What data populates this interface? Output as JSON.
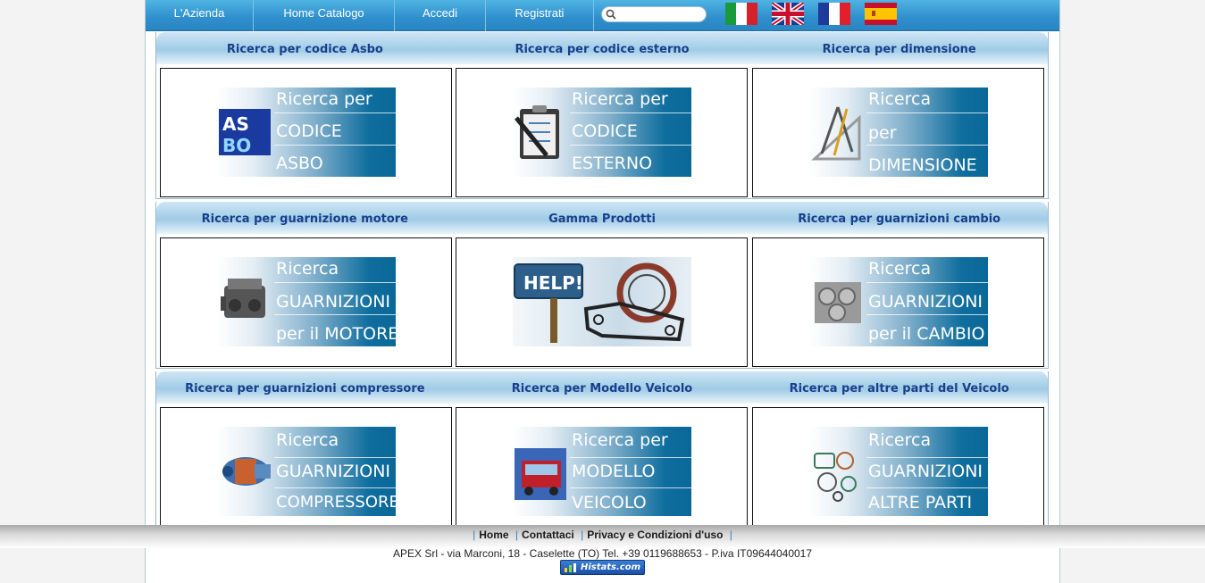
{
  "nav": {
    "items": [
      "L'Azienda",
      "Home Catalogo",
      "Accedi",
      "Registrati"
    ],
    "search_placeholder": "",
    "flags": [
      "italian-flag-icon",
      "uk-flag-icon",
      "french-flag-icon",
      "spanish-flag-icon"
    ]
  },
  "sections": [
    {
      "headers": [
        "Ricerca per codice Asbo",
        "Ricerca per codice esterno",
        "Ricerca per dimensione"
      ],
      "banners": [
        {
          "lines": [
            "Ricerca per",
            "CODICE",
            "ASBO"
          ],
          "icon": "asbo-logo-icon"
        },
        {
          "lines": [
            "Ricerca per",
            "CODICE",
            "ESTERNO"
          ],
          "icon": "clipboard-pen-icon"
        },
        {
          "lines": [
            "Ricerca",
            "per",
            "DIMENSIONE"
          ],
          "icon": "compass-ruler-icon"
        }
      ]
    },
    {
      "headers": [
        "Ricerca per guarnizione motore",
        "Gamma Prodotti",
        "Ricerca per guarnizioni cambio"
      ],
      "banners": [
        {
          "lines": [
            "Ricerca",
            "GUARNIZIONI",
            "per il MOTORE"
          ],
          "icon": "engine-icon"
        },
        {
          "lines": [],
          "icon": "help-sign-gaskets-icon",
          "sign": "HELP!"
        },
        {
          "lines": [
            "Ricerca",
            "GUARNIZIONI",
            "per il CAMBIO"
          ],
          "icon": "gearbox-icon"
        }
      ]
    },
    {
      "headers": [
        "Ricerca per guarnizioni compressore",
        "Ricerca per Modello Veicolo",
        "Ricerca per altre parti del Veicolo"
      ],
      "banners": [
        {
          "lines": [
            "Ricerca",
            "GUARNIZIONI",
            "COMPRESSORE"
          ],
          "icon": "compressor-icon"
        },
        {
          "lines": [
            "Ricerca per",
            "MODELLO",
            "VEICOLO"
          ],
          "icon": "truck-icon"
        },
        {
          "lines": [
            "Ricerca",
            "GUARNIZIONI",
            "ALTRE PARTI"
          ],
          "icon": "gasket-set-icon"
        }
      ]
    }
  ],
  "footer": {
    "links": [
      "Home",
      "Contattaci",
      "Privacy e Condizioni d'uso"
    ],
    "address": "APEX Srl - via Marconi, 18 - Caselette (TO) Tel. +39 0119688653 - P.iva IT09644040017",
    "badge": "Histats.com"
  },
  "colors": {
    "nav": "#2f8fcc",
    "header_text": "#173f8c",
    "banner_dark": "#0a6898"
  }
}
